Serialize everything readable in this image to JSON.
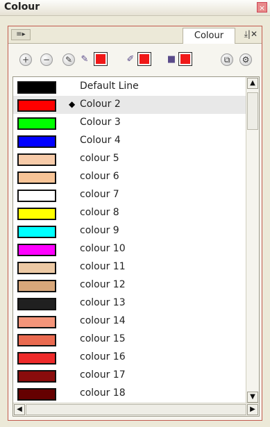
{
  "window": {
    "title": "Colour",
    "close_glyph": "×"
  },
  "panel": {
    "menu_glyph": "≡▸",
    "tab_label": "Colour",
    "tab_icons": "⤓|✕"
  },
  "toolbar": {
    "add_glyph": "+",
    "remove_glyph": "−",
    "edit_glyph": "✎",
    "clone_glyph": "⧉",
    "settings_glyph": "⚙",
    "accent_color": "#f01818"
  },
  "colour_list": [
    {
      "name": "Default Line",
      "color": "#000000"
    },
    {
      "name": "Colour 2",
      "color": "#ff0000",
      "selected": true
    },
    {
      "name": "Colour 3",
      "color": "#00ff00"
    },
    {
      "name": "Colour 4",
      "color": "#0000ff"
    },
    {
      "name": "colour 5",
      "color": "#f7cba9"
    },
    {
      "name": "colour 6",
      "color": "#f7c497"
    },
    {
      "name": "colour 7",
      "color": "#ffffff"
    },
    {
      "name": "colour 8",
      "color": "#ffff00"
    },
    {
      "name": "colour 9",
      "color": "#00ffff"
    },
    {
      "name": "colour 10",
      "color": "#ff00ff"
    },
    {
      "name": "colour 11",
      "color": "#ecc9a4"
    },
    {
      "name": "colour 12",
      "color": "#d8a77a"
    },
    {
      "name": "colour 13",
      "color": "#202020"
    },
    {
      "name": "colour 14",
      "color": "#f4957a"
    },
    {
      "name": "colour 15",
      "color": "#ea6a50"
    },
    {
      "name": "colour 16",
      "color": "#ee2a2a"
    },
    {
      "name": "colour 17",
      "color": "#8a0c0c"
    },
    {
      "name": "colour 18",
      "color": "#650000"
    }
  ],
  "scroll": {
    "up": "▲",
    "down": "▼",
    "left": "◀",
    "right": "▶"
  }
}
